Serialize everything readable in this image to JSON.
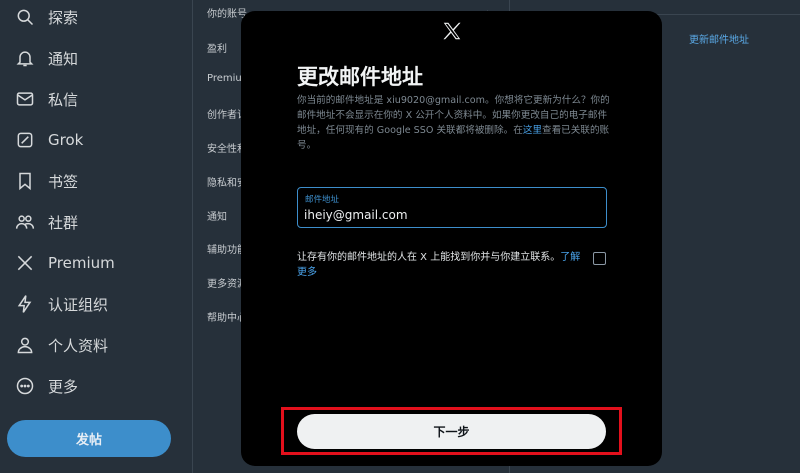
{
  "nav": {
    "items": [
      {
        "label": "探索",
        "icon": "search-icon"
      },
      {
        "label": "通知",
        "icon": "bell-icon"
      },
      {
        "label": "私信",
        "icon": "mail-icon"
      },
      {
        "label": "Grok",
        "icon": "grok-icon"
      },
      {
        "label": "书签",
        "icon": "bookmark-icon"
      },
      {
        "label": "社群",
        "icon": "community-icon"
      },
      {
        "label": "Premium",
        "icon": "x-logo-icon"
      },
      {
        "label": "认证组织",
        "icon": "lightning-icon"
      },
      {
        "label": "个人资料",
        "icon": "person-icon"
      },
      {
        "label": "更多",
        "icon": "more-circle-icon"
      }
    ],
    "post_label": "发帖"
  },
  "settings": {
    "items": [
      "你的账号",
      "盈利",
      "Premium",
      "创作者订",
      "安全性和",
      "隐私和安",
      "通知",
      "辅助功能",
      "更多资源",
      "帮助中心"
    ]
  },
  "right": {
    "update_email_link": "更新邮件地址"
  },
  "modal": {
    "title": "更改邮件地址",
    "desc_main": "你当前的邮件地址是 xiu9020@gmail.com。你想将它更新为什么？你的邮件地址不会显示在你的 X 公开个人资料中。如果你更改自己的电子邮件地址，任何现有的 Google SSO 关联都将被删除。在",
    "desc_link": "这里",
    "desc_tail": "查看已关联的账号。",
    "email_label": "邮件地址",
    "email_value": "iheiy@gmail.com",
    "discover_text": "让存有你的邮件地址的人在 X 上能找到你并与你建立联系。",
    "discover_link": "了解更多",
    "next_label": "下一步"
  },
  "colors": {
    "accent": "#3d8ecb",
    "link": "#4aa3ea",
    "highlight": "#e3101c",
    "modal_bg": "#000000",
    "page_bg": "#26303a"
  }
}
